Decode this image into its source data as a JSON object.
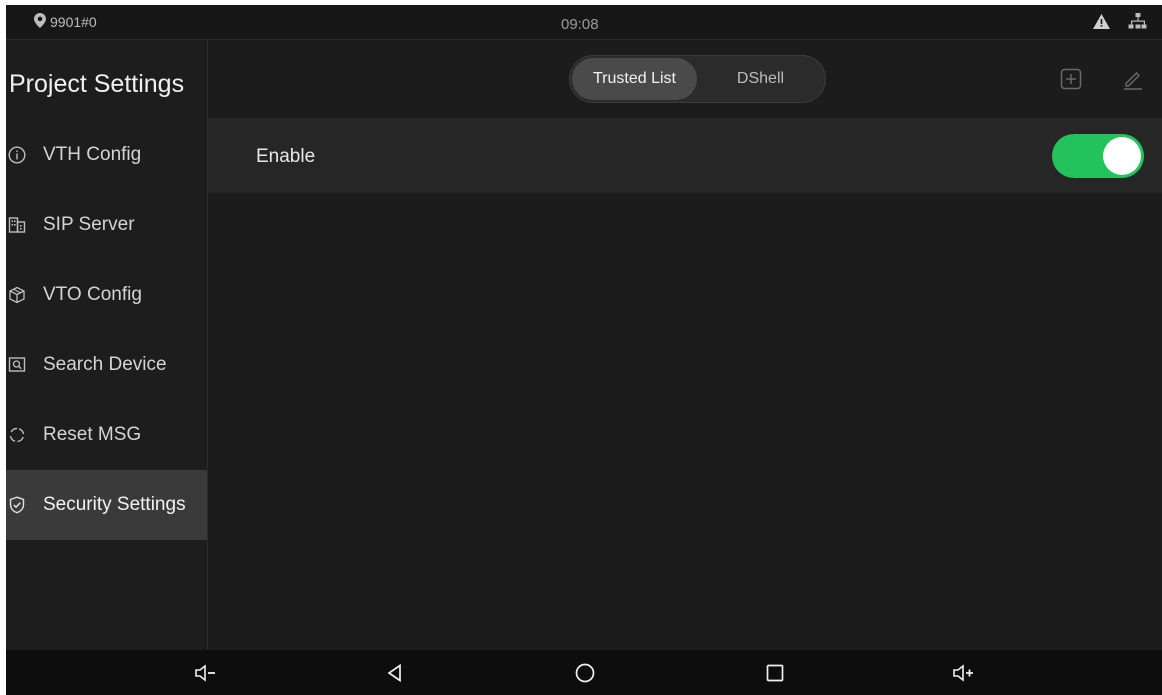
{
  "status_bar": {
    "location": "9901#0",
    "time": "09:08",
    "icons": [
      "location-pin-icon",
      "warning-icon",
      "network-icon"
    ]
  },
  "sidebar": {
    "title": "Project Settings",
    "items": [
      {
        "label": "VTH Config",
        "icon": "info-icon",
        "active": false
      },
      {
        "label": "SIP Server",
        "icon": "building-icon",
        "active": false
      },
      {
        "label": "VTO Config",
        "icon": "cube-icon",
        "active": false
      },
      {
        "label": "Search Device",
        "icon": "search-device-icon",
        "active": false
      },
      {
        "label": "Reset MSG",
        "icon": "reset-icon",
        "active": false
      },
      {
        "label": "Security Settings",
        "icon": "shield-check-icon",
        "active": true
      }
    ]
  },
  "tabs": {
    "selected": "Trusted List",
    "items": [
      "Trusted List",
      "DShell"
    ]
  },
  "actions": [
    "add-icon",
    "edit-icon"
  ],
  "enable": {
    "label": "Enable",
    "on": true,
    "color_on": "#23c25d"
  },
  "navigation_bar": [
    "volume-down-icon",
    "back-icon",
    "home-icon",
    "recents-icon",
    "volume-up-icon"
  ]
}
